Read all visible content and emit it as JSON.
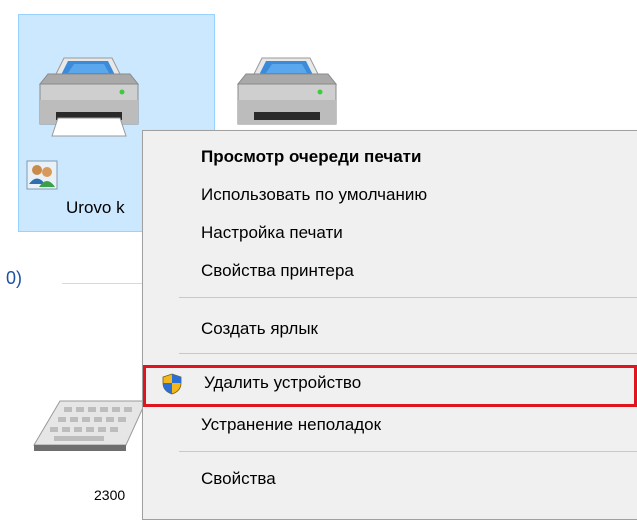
{
  "devices": {
    "selected_printer_label": "Urovo k",
    "section_counter": "0)",
    "keyboard_label": "2300"
  },
  "context_menu": {
    "items": [
      {
        "label": "Просмотр очереди печати",
        "bold": true
      },
      {
        "label": "Использовать по умолчанию"
      },
      {
        "label": "Настройка печати"
      },
      {
        "label": "Свойства принтера"
      },
      {
        "label": "Создать ярлык"
      },
      {
        "label": "Удалить устройство",
        "icon": "uac-shield-icon",
        "highlighted": true
      },
      {
        "label": "Устранение неполадок"
      },
      {
        "label": "Свойства"
      }
    ]
  },
  "colors": {
    "selection_bg": "#cce8ff",
    "selection_border": "#99d1ff",
    "highlight_border": "#e0141e",
    "menu_bg": "#f0f0f0",
    "link_blue": "#1e50a2"
  }
}
